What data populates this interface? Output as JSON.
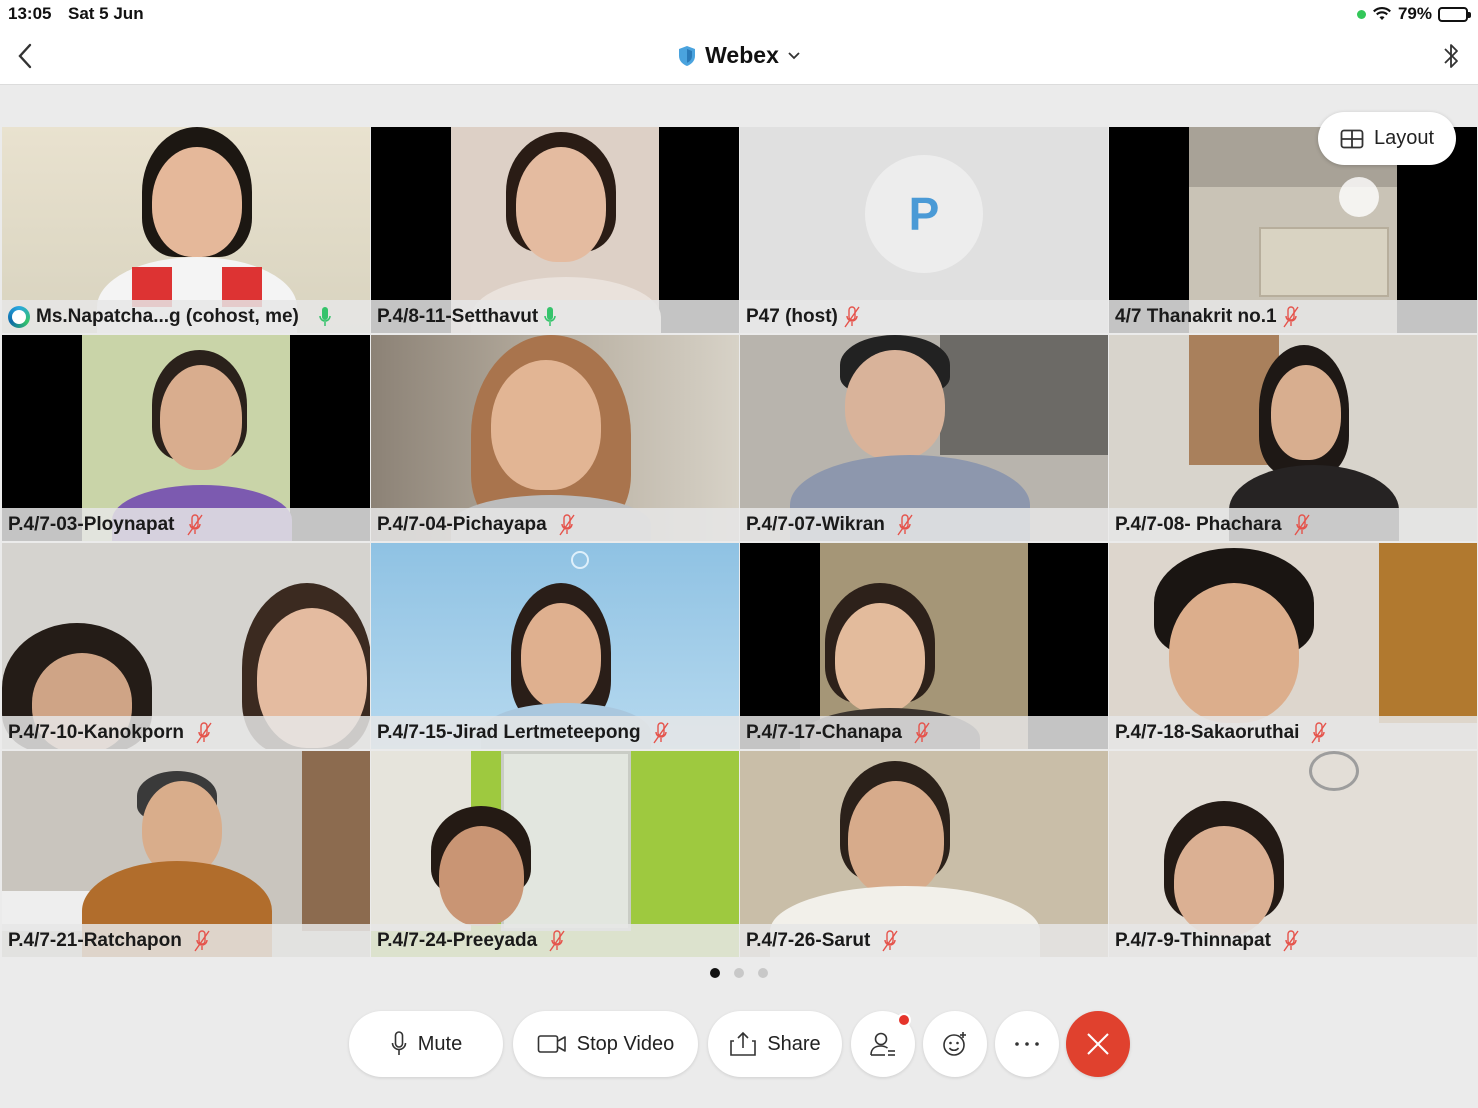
{
  "status_bar": {
    "time": "13:05",
    "date": "Sat 5 Jun",
    "battery": "79%"
  },
  "nav": {
    "title": "Webex"
  },
  "layout_button": {
    "label": "Layout"
  },
  "participants": [
    {
      "name": "Ms.Napatcha...g (cohost, me)",
      "mic": "on",
      "video": "on"
    },
    {
      "name": "P.4/8-11-Setthavut",
      "mic": "on",
      "video": "on"
    },
    {
      "name": "P47 (host)",
      "mic": "muted",
      "video": "off",
      "initial": "P"
    },
    {
      "name": "4/7 Thanakrit no.1",
      "mic": "muted",
      "video": "on"
    },
    {
      "name": "P.4/7-03-Ploynapat",
      "mic": "muted",
      "video": "on"
    },
    {
      "name": "P.4/7-04-Pichayapa",
      "mic": "muted",
      "video": "on"
    },
    {
      "name": "P.4/7-07-Wikran",
      "mic": "muted",
      "video": "on"
    },
    {
      "name": "P.4/7-08- Phachara",
      "mic": "muted",
      "video": "on"
    },
    {
      "name": "P.4/7-10-Kanokporn",
      "mic": "muted",
      "video": "on"
    },
    {
      "name": "P.4/7-15-Jirad Lertmeteepong",
      "mic": "muted",
      "video": "on"
    },
    {
      "name": "P.4/7-17-Chanapa",
      "mic": "muted",
      "video": "on"
    },
    {
      "name": "P.4/7-18-Sakaoruthai",
      "mic": "muted",
      "video": "on"
    },
    {
      "name": "P.4/7-21-Ratchapon",
      "mic": "muted",
      "video": "on"
    },
    {
      "name": "P.4/7-24-Preeyada",
      "mic": "muted",
      "video": "on"
    },
    {
      "name": "P.4/7-26-Sarut",
      "mic": "muted",
      "video": "on"
    },
    {
      "name": "P.4/7-9-Thinnapat",
      "mic": "muted",
      "video": "on"
    }
  ],
  "pager": {
    "pages": 3,
    "current": 1
  },
  "controls": {
    "mute_label": "Mute",
    "stop_video_label": "Stop Video",
    "share_label": "Share"
  },
  "colors": {
    "accent": "#2f6f9f",
    "end_call": "#e0412e",
    "mic_on": "#35c36b",
    "mic_muted": "#e5534b",
    "avatar_text": "#4a9ad6"
  },
  "icons": [
    "back-chevron-icon",
    "webex-shield-icon",
    "chevron-down-icon",
    "bluetooth-icon",
    "layout-grid-icon",
    "microphone-icon",
    "camera-icon",
    "share-icon",
    "participants-icon",
    "reactions-icon",
    "more-icon",
    "close-icon"
  ]
}
